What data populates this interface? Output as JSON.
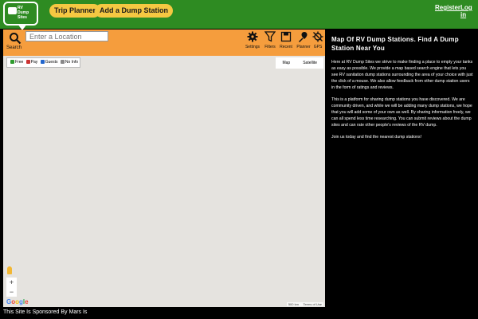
{
  "header": {
    "logo_text": [
      "RV",
      "Dump",
      "Sites"
    ],
    "nav": [
      "Trip Planner",
      "Add a Dump Station"
    ],
    "register": "Register",
    "login": "Log in"
  },
  "toolbar": {
    "search_label": "Search",
    "search_placeholder": "Enter a Location",
    "tools": [
      {
        "label": "Settings",
        "icon": "gear-icon"
      },
      {
        "label": "Filters",
        "icon": "funnel-icon"
      },
      {
        "label": "Recent",
        "icon": "save-icon"
      },
      {
        "label": "Planner",
        "icon": "route-pin-icon"
      },
      {
        "label": "GPS",
        "icon": "gps-off-icon"
      }
    ]
  },
  "map": {
    "filters": [
      {
        "label": "Free",
        "color": "#2e9b2e"
      },
      {
        "label": "Pay",
        "color": "#cc3333"
      },
      {
        "label": "Guests",
        "color": "#2266cc"
      },
      {
        "label": "No Info",
        "color": "#888888"
      }
    ],
    "map_types": [
      "Map",
      "Satellite"
    ],
    "zoom_in": "+",
    "zoom_out": "−",
    "google_logo": "Google",
    "scale": "500 km",
    "terms": "Terms of Use"
  },
  "info": {
    "title": "Map Of RV Dump Stations. Find A Dump Station Near You",
    "paragraphs": [
      "Here at RV Dump Sites we strive to make finding a place to empty your tanks as easy as possible. We provide a map based search engine that lets you see RV sanitation dump stations surrounding the area of your choice with just the click of a mouse. We also allow feedback from other dump station users in the form of ratings and reviews.",
      "This is a platform for sharing dump stations you have discovered. We are community driven, and while we will be adding many dump stations, we hope that you will add some of your own as well. By sharing information freely, we can all spend less time researching. You can submit reviews about the dump sites and can rate other people's reviews of the RV dump.",
      "Join us today and find the nearest dump stations!"
    ]
  },
  "footer": {
    "text": "This Site Is Sponsored By Mars Is"
  }
}
